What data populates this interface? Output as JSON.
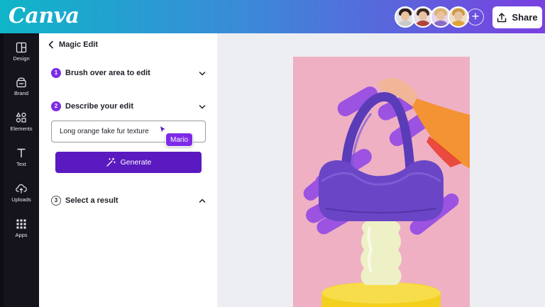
{
  "app": {
    "logo_text": "Canva"
  },
  "topbar": {
    "collaborators": [
      {
        "name": "avatar-1",
        "hair": "#2b1d18",
        "shirt": "#c9c9c9"
      },
      {
        "name": "avatar-2",
        "hair": "#3a2a22",
        "shirt": "#b0453b"
      },
      {
        "name": "avatar-3",
        "hair": "#d9b46a",
        "shirt": "#8a6cc7"
      },
      {
        "name": "avatar-4",
        "hair": "#c99a44",
        "shirt": "#e0a43c"
      }
    ],
    "add_collaborator_symbol": "+",
    "share_label": "Share"
  },
  "sidebar": {
    "items": [
      {
        "label": "Design",
        "icon": "layout-icon"
      },
      {
        "label": "Brand",
        "icon": "brand-kit-icon"
      },
      {
        "label": "Elements",
        "icon": "elements-icon"
      },
      {
        "label": "Text",
        "icon": "text-icon"
      },
      {
        "label": "Uploads",
        "icon": "upload-cloud-icon"
      },
      {
        "label": "Apps",
        "icon": "apps-grid-icon"
      }
    ]
  },
  "panel": {
    "title": "Magic Edit",
    "steps": [
      {
        "number": "1",
        "label": "Brush over area to edit",
        "state": "collapsed"
      },
      {
        "number": "2",
        "label": "Describe your edit",
        "state": "expanded"
      },
      {
        "number": "3",
        "label": "Select a result",
        "state": "expanded"
      }
    ],
    "edit_prompt_value": "Long orange fake fur texture",
    "generate_label": "Generate",
    "cursor_user": "Mario"
  },
  "colors": {
    "accent_purple": "#7d2ae8",
    "generate_button": "#5a1ac0",
    "rail_background": "#15131c",
    "artboard_background": "#efb0c4",
    "brush_overlay": "#8b3fe8",
    "pedestal": "#f3cf1f"
  }
}
